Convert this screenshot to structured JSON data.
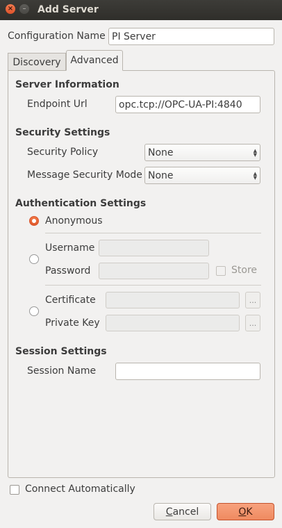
{
  "window": {
    "title": "Add Server",
    "close_glyph": "×",
    "min_glyph": "–"
  },
  "config": {
    "label": "Configuration Name",
    "value": "PI Server"
  },
  "tabs": [
    {
      "label": "Discovery",
      "active": false
    },
    {
      "label": "Advanced",
      "active": true
    }
  ],
  "server_info": {
    "heading": "Server Information",
    "endpoint_label": "Endpoint Url",
    "endpoint_value": "opc.tcp://OPC-UA-PI:4840"
  },
  "security": {
    "heading": "Security Settings",
    "policy_label": "Security Policy",
    "policy_value": "None",
    "mode_label": "Message Security Mode",
    "mode_value": "None"
  },
  "auth": {
    "heading": "Authentication Settings",
    "anonymous_label": "Anonymous",
    "selected": "anonymous",
    "username_label": "Username",
    "password_label": "Password",
    "store_label": "Store",
    "certificate_label": "Certificate",
    "private_key_label": "Private Key",
    "browse_label": "..."
  },
  "session": {
    "heading": "Session Settings",
    "name_label": "Session Name",
    "name_value": ""
  },
  "footer": {
    "connect_auto_label": "Connect Automatically",
    "cancel_first": "C",
    "cancel_rest": "ancel",
    "ok_first": "O",
    "ok_rest": "K"
  }
}
